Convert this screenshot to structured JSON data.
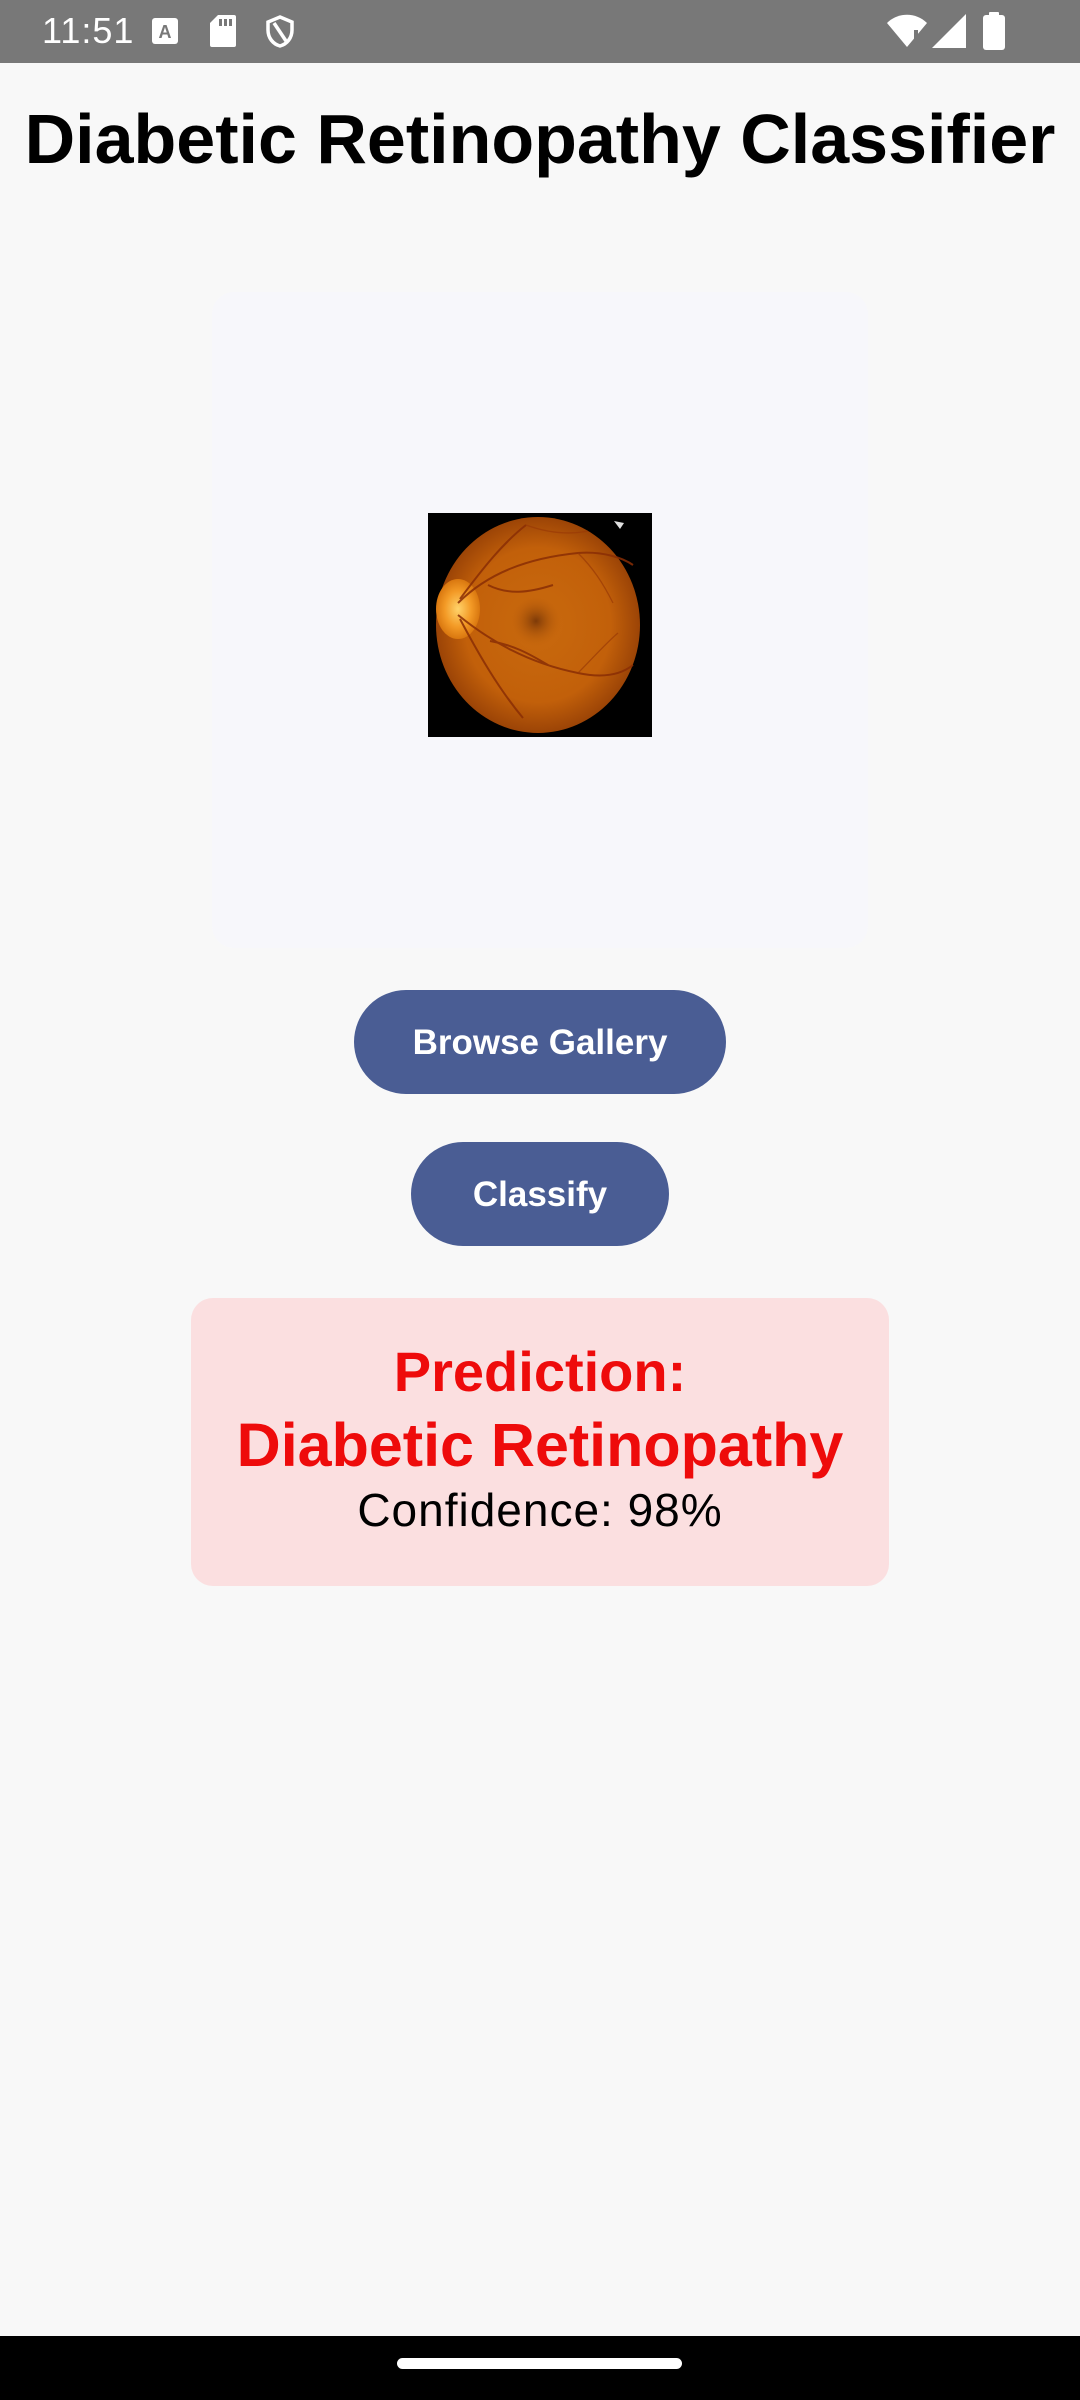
{
  "status_bar": {
    "time": "11:51",
    "left_icons": [
      "a-notification-icon",
      "sd-card-icon",
      "shield-icon"
    ],
    "right_icons": [
      "wifi-icon",
      "signal-icon",
      "battery-icon"
    ]
  },
  "app": {
    "title": "Diabetic Retinopathy Classifier"
  },
  "image_card": {
    "image_alt": "retina fundus image"
  },
  "buttons": {
    "browse_label": "Browse Gallery",
    "classify_label": "Classify"
  },
  "result": {
    "label": "Prediction:",
    "value": "Diabetic Retinopathy",
    "confidence": "Confidence: 98%"
  },
  "colors": {
    "button": "#4a5d94",
    "prediction_text": "#ee0b0b",
    "result_background": "#fbdfe0"
  }
}
